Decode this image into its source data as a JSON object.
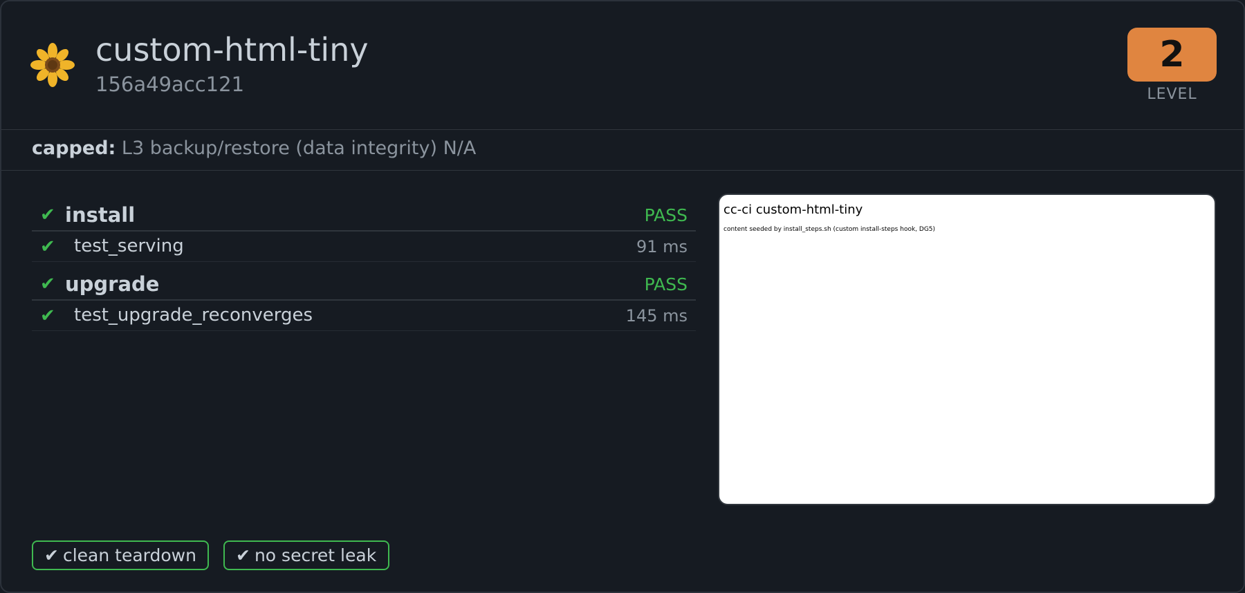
{
  "header": {
    "title": "custom-html-tiny",
    "hash": "156a49acc121",
    "level_value": "2",
    "level_label": "LEVEL",
    "icon": "sunflower-icon"
  },
  "capped": {
    "key": "capped:",
    "value": "L3 backup/restore (data integrity) N/A"
  },
  "groups": [
    {
      "name": "install",
      "status": "PASS",
      "tests": [
        {
          "name": "test_serving",
          "time": "91 ms"
        }
      ]
    },
    {
      "name": "upgrade",
      "status": "PASS",
      "tests": [
        {
          "name": "test_upgrade_reconverges",
          "time": "145 ms"
        }
      ]
    }
  ],
  "preview": {
    "title": "cc-ci custom-html-tiny",
    "text": "content seeded by install_steps.sh (custom install-steps hook, DG5)"
  },
  "badges": [
    {
      "label": "clean teardown"
    },
    {
      "label": "no secret leak"
    }
  ],
  "glyphs": {
    "check": "✔"
  },
  "colors": {
    "background": "#161b22",
    "pass": "#3fb950",
    "level_badge": "#e08540",
    "muted": "#8b949e",
    "text": "#c9d1d9"
  }
}
